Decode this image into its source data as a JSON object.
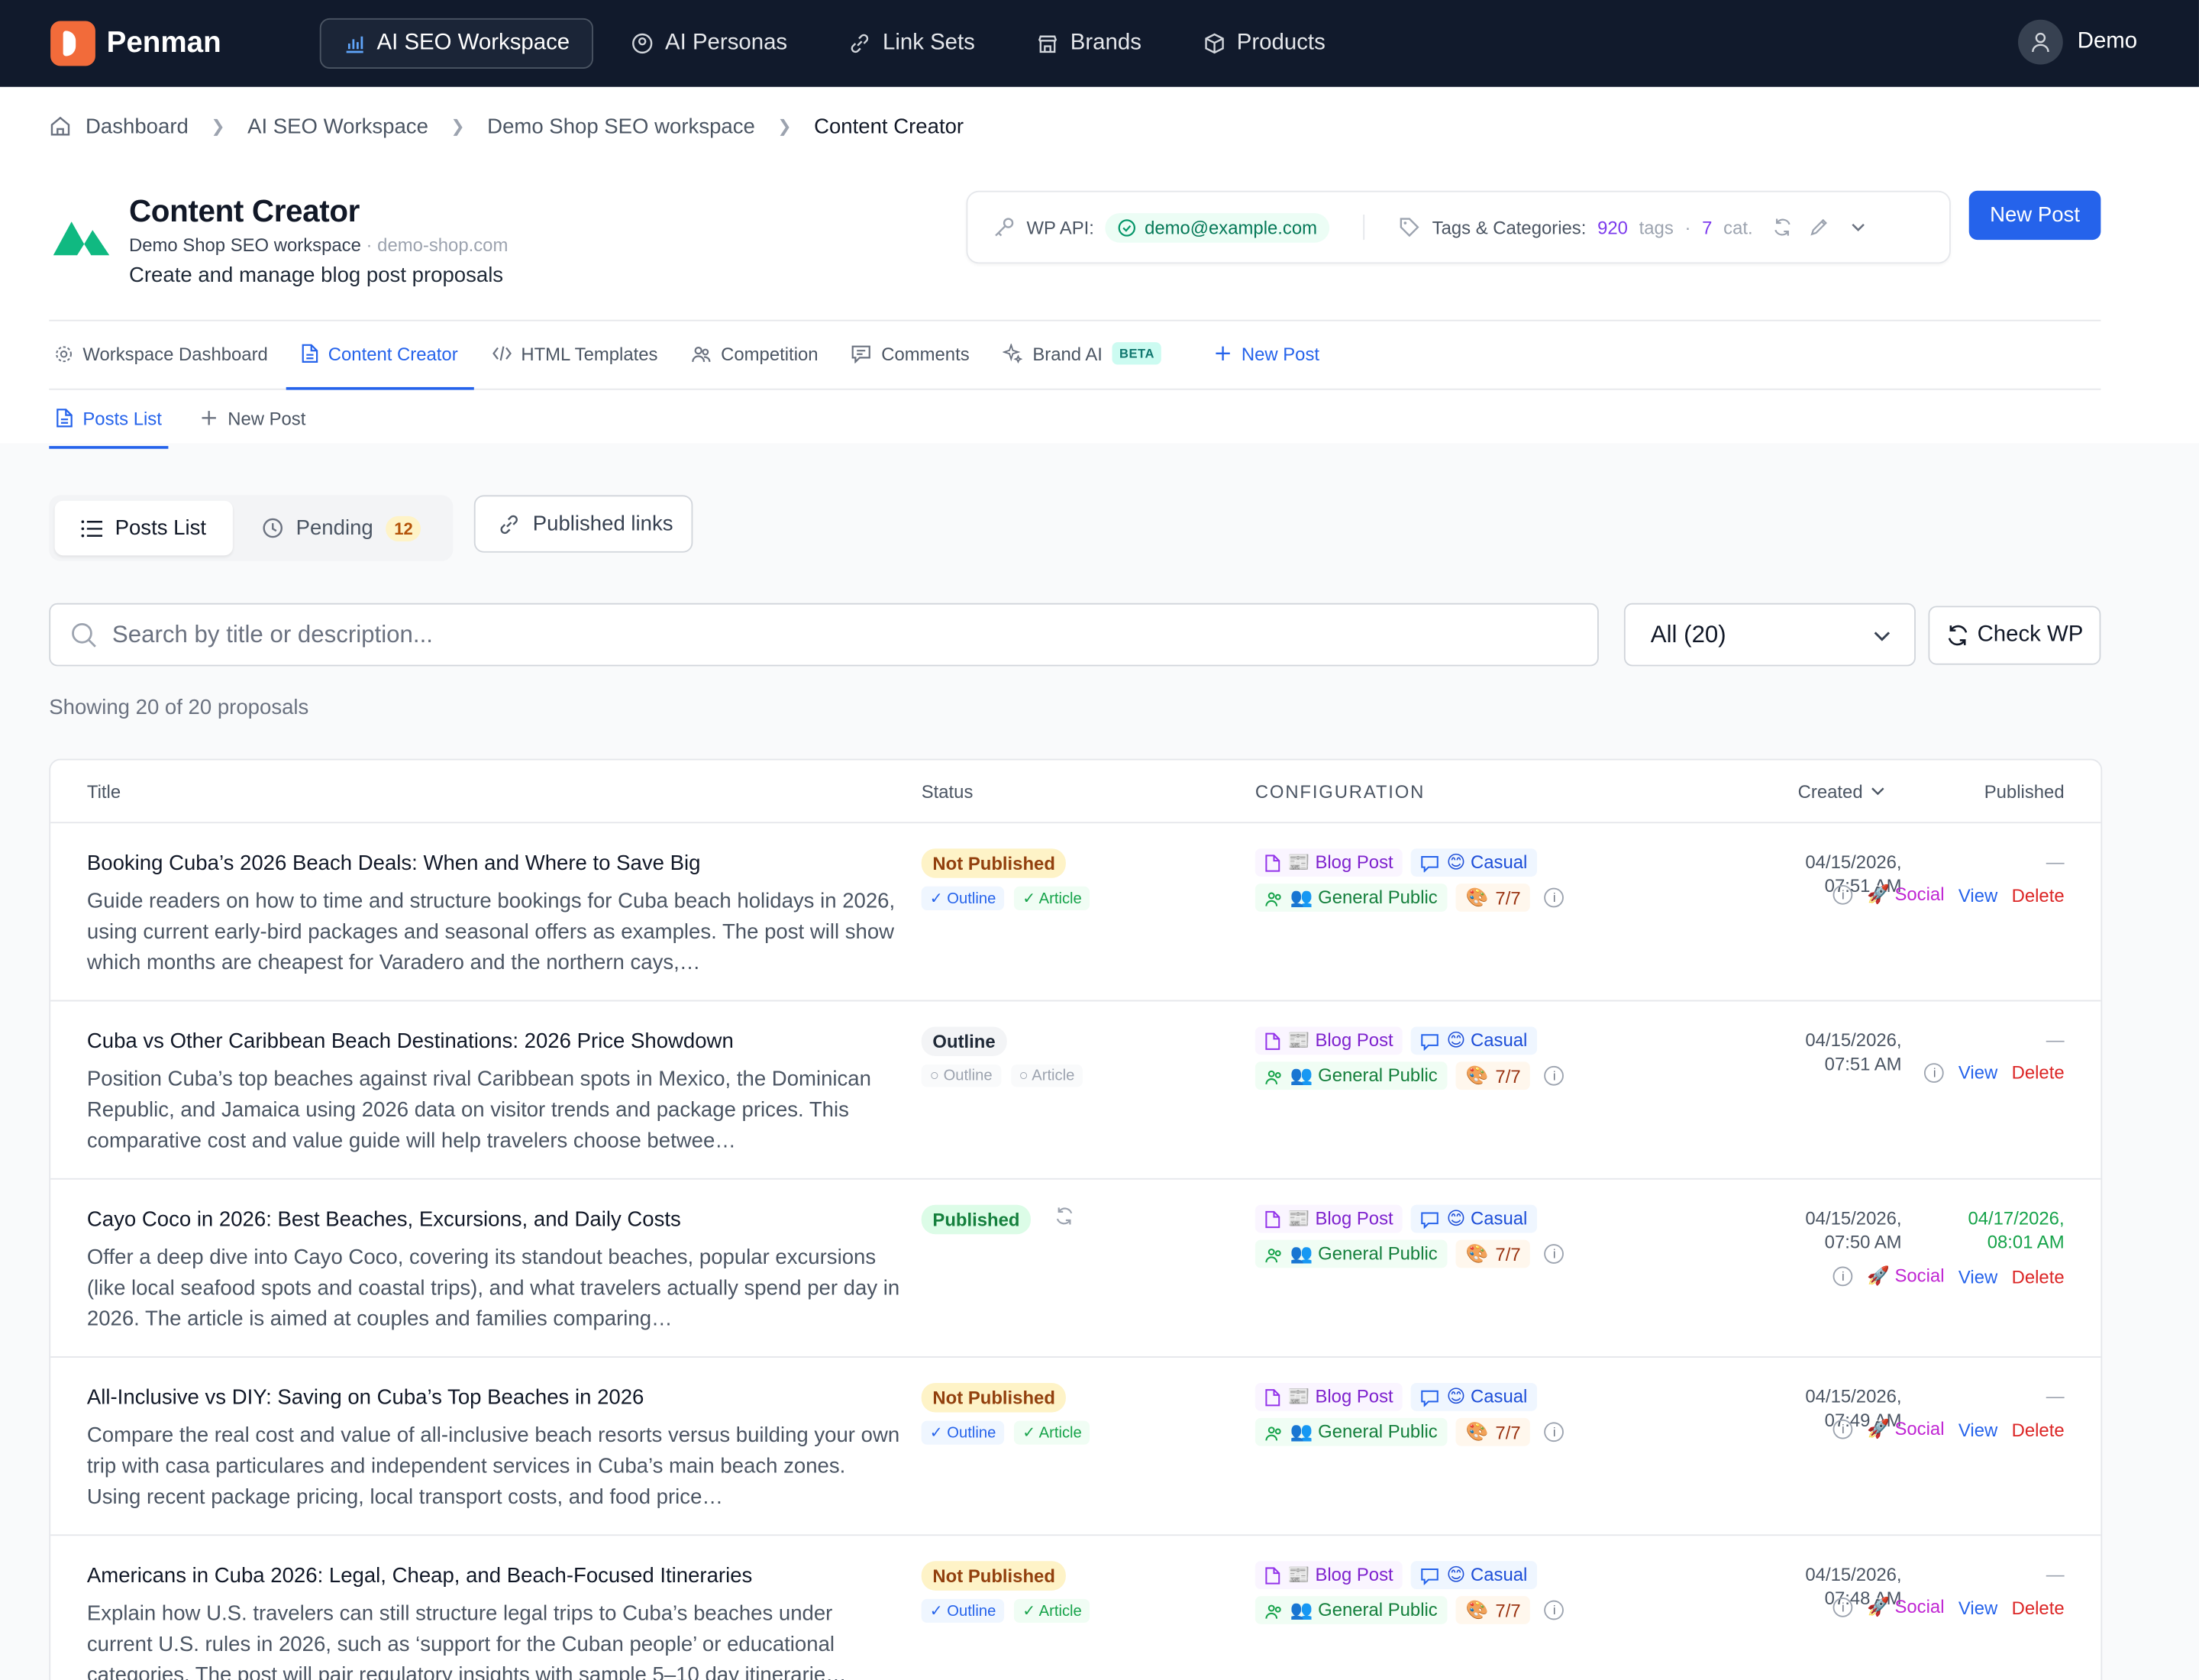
{
  "nav": {
    "logo": "Penman",
    "items": [
      {
        "label": "AI SEO Workspace",
        "icon": "chart-icon",
        "active": true
      },
      {
        "label": "AI Personas",
        "icon": "persona-icon"
      },
      {
        "label": "Link Sets",
        "icon": "link-icon"
      },
      {
        "label": "Brands",
        "icon": "store-icon"
      },
      {
        "label": "Products",
        "icon": "box-icon"
      }
    ],
    "user": "Demo"
  },
  "breadcrumb": [
    "Dashboard",
    "AI SEO Workspace",
    "Demo Shop SEO workspace",
    "Content Creator"
  ],
  "header": {
    "title": "Content Creator",
    "workspace": "Demo Shop SEO workspace",
    "domain": "demo-shop.com",
    "description": "Create and manage blog post proposals",
    "wp_label": "WP API:",
    "wp_email": "demo@example.com",
    "tags_label": "Tags & Categories:",
    "tags_count": "920",
    "tags_word": "tags",
    "cat_count": "7",
    "cat_word": "cat.",
    "new_post": "New Post"
  },
  "tabs": [
    "Workspace Dashboard",
    "Content Creator",
    "HTML Templates",
    "Competition",
    "Comments",
    "Brand AI",
    "New Post"
  ],
  "beta": "BETA",
  "subtabs": [
    "Posts List",
    "New Post"
  ],
  "toolbar": {
    "posts_list": "Posts List",
    "pending": "Pending",
    "pending_count": "12",
    "published_links": "Published links",
    "search_placeholder": "Search by title or description...",
    "filter": "All (20)",
    "check_wp": "Check WP",
    "showing": "Showing 20 of 20 proposals"
  },
  "table": {
    "headers": {
      "title": "Title",
      "status": "Status",
      "config": "CONFIGURATION",
      "created": "Created",
      "published": "Published"
    },
    "chips": {
      "type": "📰 Blog Post",
      "tone": "😊 Casual",
      "audience": "👥 General Public",
      "score": "7/7"
    },
    "flags": {
      "outline": "Outline",
      "article": "Article"
    },
    "actions": {
      "social": "Social",
      "view": "View",
      "delete": "Delete"
    },
    "rows": [
      {
        "title": "Booking Cuba’s 2026 Beach Deals: When and Where to Save Big",
        "desc": "Guide readers on how to time and structure bookings for Cuba beach holidays in 2026, using current early-bird packages and seasonal offers as examples. The post will show which months are cheapest for Varadero and the northern cays,…",
        "status": "Not Published",
        "created_date": "04/15/2026,",
        "created_time": "07:51 AM",
        "published": "—"
      },
      {
        "title": "Cuba vs Other Caribbean Beach Destinations: 2026 Price Showdown",
        "desc": "Position Cuba’s top beaches against rival Caribbean spots in Mexico, the Dominican Republic, and Jamaica using 2026 data on visitor trends and package prices. This comparative cost and value guide will help travelers choose betwee…",
        "status": "Outline",
        "created_date": "04/15/2026,",
        "created_time": "07:51 AM",
        "published": "—"
      },
      {
        "title": "Cayo Coco in 2026: Best Beaches, Excursions, and Daily Costs",
        "desc": "Offer a deep dive into Cayo Coco, covering its standout beaches, popular excursions (like local seafood spots and coastal trips), and what travelers actually spend per day in 2026. The article is aimed at couples and families comparing…",
        "status": "Published",
        "created_date": "04/15/2026,",
        "created_time": "07:50 AM",
        "published_date": "04/17/2026,",
        "published_time": "08:01 AM"
      },
      {
        "title": "All-Inclusive vs DIY: Saving on Cuba’s Top Beaches in 2026",
        "desc": "Compare the real cost and value of all-inclusive beach resorts versus building your own trip with casa particulares and independent services in Cuba’s main beach zones. Using recent package pricing, local transport costs, and food price…",
        "status": "Not Published",
        "created_date": "04/15/2026,",
        "created_time": "07:49 AM",
        "published": "—"
      },
      {
        "title": "Americans in Cuba 2026: Legal, Cheap, and Beach-Focused Itineraries",
        "desc": "Explain how U.S. travelers can still structure legal trips to Cuba’s beaches under current U.S. rules in 2026, such as ‘support for the Cuban people’ or educational categories. The post will pair regulatory insights with sample 5–10 day itinerarie…",
        "status": "Not Published",
        "created_date": "04/15/2026,",
        "created_time": "07:48 AM",
        "published": "—"
      }
    ]
  },
  "colors": {
    "nav_bg": "#111a2c",
    "primary": "#2563eb",
    "brand_orange": "#f26b3a",
    "brand_green": "#10b981"
  }
}
